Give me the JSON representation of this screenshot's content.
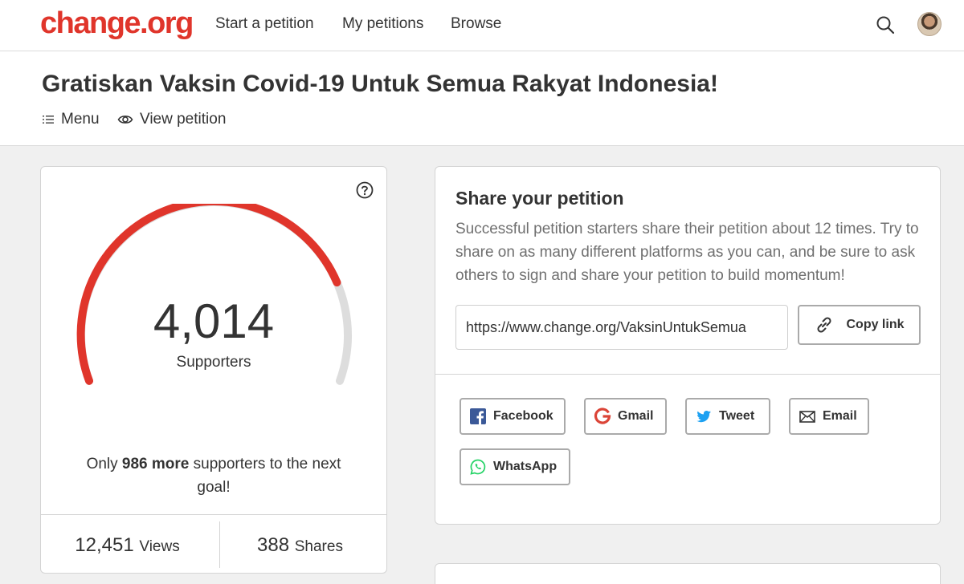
{
  "nav": {
    "logo": "change.org",
    "links": [
      "Start a petition",
      "My petitions",
      "Browse"
    ],
    "search_icon": "search-icon",
    "avatar": "user-avatar"
  },
  "petition": {
    "title": "Gratiskan Vaksin Covid-19 Untuk Semua Rakyat Indonesia!",
    "menu_label": "Menu",
    "view_label": "View petition"
  },
  "supporters": {
    "count": "4,014",
    "label": "Supporters",
    "goal_progress": 0.8028,
    "goal_prefix": "Only ",
    "goal_bold": "986 more",
    "goal_suffix": " supporters to the next goal!",
    "views_value": "12,451",
    "views_label": "Views",
    "shares_value": "388",
    "shares_label": "Shares"
  },
  "share": {
    "title": "Share your petition",
    "description": "Successful petition starters share their petition about 12 times. Try to share on as many different platforms as you can, and be sure to ask others to sign and share your petition to build momentum!",
    "url": "https://www.change.org/VaksinUntukSemua",
    "copy_label": "Copy link",
    "buttons": {
      "facebook": "Facebook",
      "gmail": "Gmail",
      "tweet": "Tweet",
      "email": "Email",
      "whatsapp": "WhatsApp"
    }
  },
  "colors": {
    "brand": "#e0352b",
    "gauge_track": "#dddddd",
    "facebook": "#3b5998",
    "twitter": "#1da1f2",
    "whatsapp": "#25d366"
  }
}
